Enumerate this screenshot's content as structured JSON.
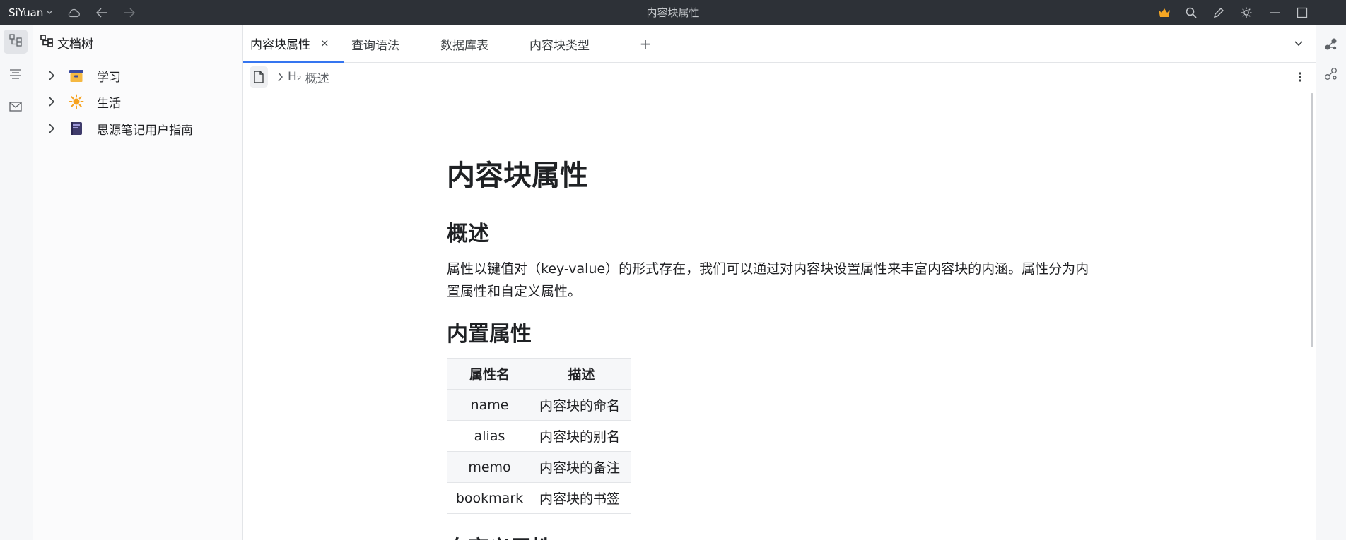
{
  "titlebar": {
    "app_name": "SiYuan",
    "window_title": "内容块属性",
    "icons": [
      "chevron-down-icon",
      "cloud-sync-icon",
      "back-arrow-icon",
      "forward-arrow-icon",
      "vip-crown-icon",
      "search-icon",
      "edit-pen-icon",
      "theme-sun-icon",
      "minimize-icon",
      "maximize-icon"
    ],
    "crown_color": "#f5a623"
  },
  "dock_left": {
    "items": [
      "file-tree-icon",
      "outline-icon",
      "inbox-icon"
    ]
  },
  "filetree": {
    "title": "文档树",
    "notebooks": [
      {
        "label": "学习",
        "icon": "archive-box-icon"
      },
      {
        "label": "生活",
        "icon": "sun-icon"
      },
      {
        "label": "思源笔记用户指南",
        "icon": "notebook-icon"
      }
    ]
  },
  "tabs": [
    {
      "label": "内容块属性",
      "active": true,
      "close": "×"
    },
    {
      "label": "查询语法",
      "active": false
    },
    {
      "label": "数据库表",
      "active": false
    },
    {
      "label": "内容块类型",
      "active": false
    }
  ],
  "tab_add": "+",
  "breadcrumb": {
    "level": "H₂",
    "item": "概述"
  },
  "doc": {
    "title": "内容块属性",
    "h_overview": "概述",
    "paragraph": "属性以键值对（key-value）的形式存在，我们可以通过对内容块设置属性来丰富内容块的内涵。属性分为内置属性和自定义属性。",
    "h_builtin": "内置属性",
    "table": {
      "headers": [
        "属性名",
        "描述"
      ],
      "rows": [
        [
          "name",
          "内容块的命名"
        ],
        [
          "alias",
          "内容块的别名"
        ],
        [
          "memo",
          "内容块的备注"
        ],
        [
          "bookmark",
          "内容块的书签"
        ]
      ]
    },
    "h_custom": "自定义属性"
  },
  "accent_color": "#3575f0"
}
